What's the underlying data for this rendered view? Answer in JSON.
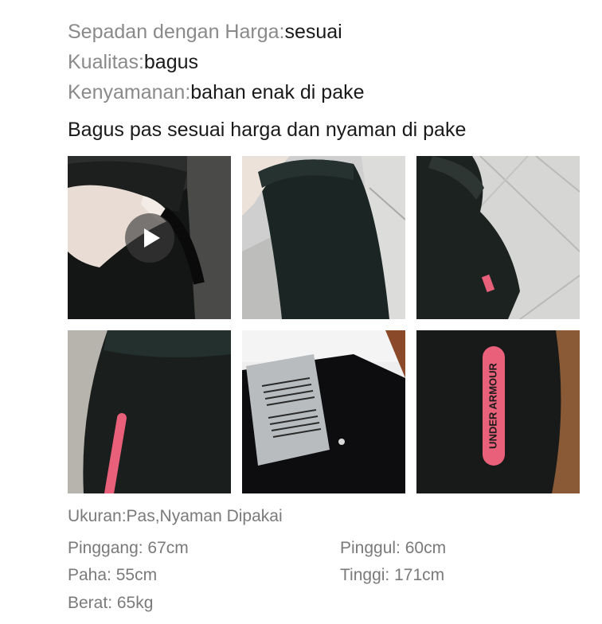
{
  "review": {
    "price_label": "Sepadan dengan Harga:",
    "price_value": "sesuai",
    "quality_label": "Kualitas:",
    "quality_value": "bagus",
    "comfort_label": "Kenyamanan:",
    "comfort_value": "bahan enak di pake",
    "comment": "Bagus pas sesuai harga dan nyaman di pake"
  },
  "photo_text": {
    "brand_on_pants": "UNDER ARMOUR"
  },
  "colors": {
    "label_gray": "#8a8a8a",
    "value_dark": "#1a1a1a",
    "accent_pink": "#e8607a"
  },
  "details": {
    "size": "Ukuran:Pas,Nyaman Dipakai",
    "waist": "Pinggang: 67cm",
    "hip": "Pinggul: 60cm",
    "thigh": "Paha: 55cm",
    "height": "Tinggi: 171cm",
    "weight": "Berat: 65kg"
  }
}
